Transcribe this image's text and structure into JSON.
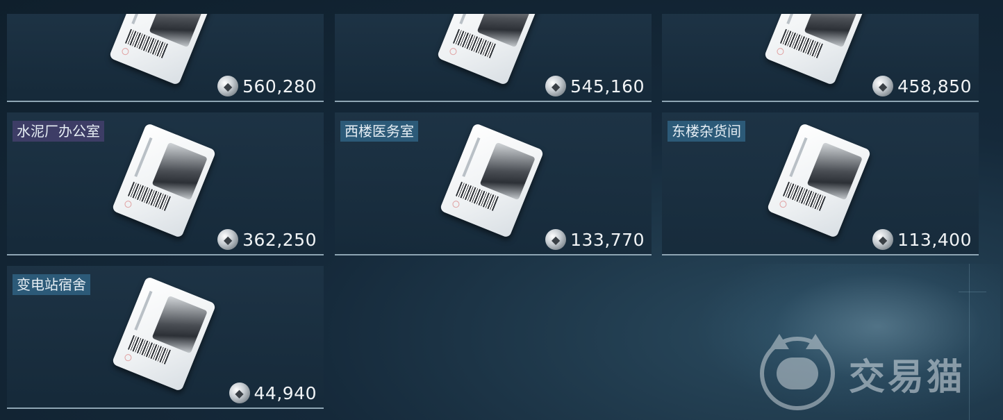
{
  "items": [
    {
      "name": "",
      "price": "560,280",
      "row": "top",
      "col": 1
    },
    {
      "name": "",
      "price": "545,160",
      "row": "top",
      "col": 2
    },
    {
      "name": "",
      "price": "458,850",
      "row": "top",
      "col": 3
    },
    {
      "name": "水泥厂办公室",
      "price": "362,250",
      "row": "row2",
      "col": 1,
      "label_color": "#3d3d66"
    },
    {
      "name": "西楼医务室",
      "price": "133,770",
      "row": "row2",
      "col": 2,
      "label_color": "#2c5a78"
    },
    {
      "name": "东楼杂货间",
      "price": "113,400",
      "row": "row2",
      "col": 3,
      "label_color": "#2c5a78"
    },
    {
      "name": "变电站宿舍",
      "price": "44,940",
      "row": "row3",
      "col": 1,
      "label_color": "#2c5a78"
    }
  ],
  "watermark": {
    "text": "交易猫",
    "icon": "cat-logo-icon"
  },
  "currency_icon": "coin-icon",
  "item_icon": "keycard-icon"
}
